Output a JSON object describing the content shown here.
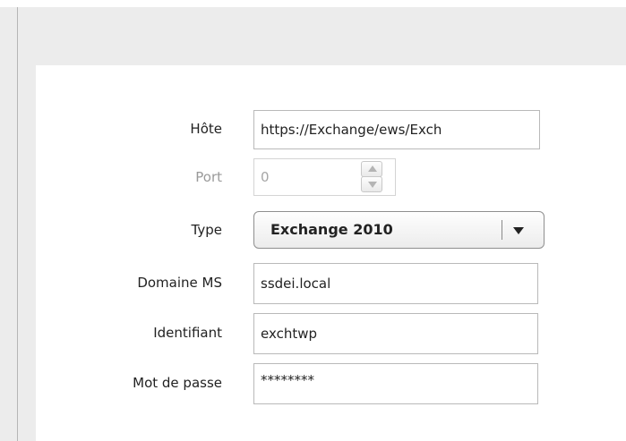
{
  "form": {
    "host": {
      "label": "Hôte",
      "value": "https://Exchange/ews/Exch"
    },
    "port": {
      "label": "Port",
      "value": "0"
    },
    "type": {
      "label": "Type",
      "value": "Exchange 2010"
    },
    "domain": {
      "label": "Domaine MS",
      "value": "ssdei.local"
    },
    "identifier": {
      "label": "Identifiant",
      "value": "exchtwp"
    },
    "password": {
      "label": "Mot de passe",
      "value": "********"
    }
  },
  "icons": {
    "spin_up": "spinner-up-arrow-icon",
    "spin_down": "spinner-down-arrow-icon",
    "dropdown": "dropdown-arrow-icon"
  }
}
